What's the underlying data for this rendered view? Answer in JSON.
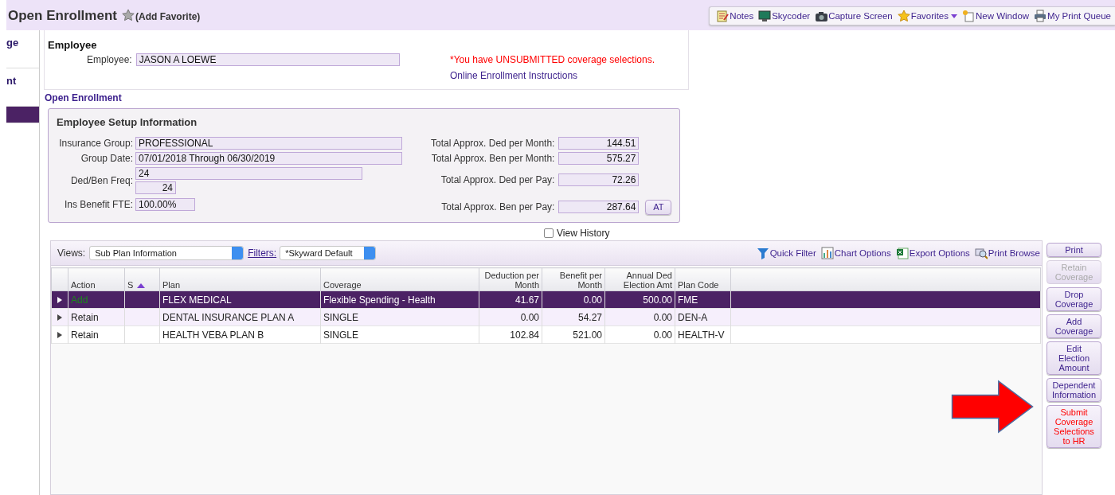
{
  "page": {
    "title": "Open Enrollment",
    "favorite": "(Add Favorite)"
  },
  "toolbar": [
    {
      "label": "Notes",
      "kind": "notes"
    },
    {
      "label": "Skycoder",
      "kind": "monitor"
    },
    {
      "label": "Capture Screen",
      "kind": "camera"
    },
    {
      "label": "Favorites",
      "kind": "star",
      "dropdown": true
    },
    {
      "label": "New Window",
      "kind": "window"
    },
    {
      "label": "My Print Queue",
      "kind": "printer"
    }
  ],
  "side_nav": [
    {
      "label": "ge",
      "selected": false
    },
    {
      "label": "nt",
      "selected": false
    },
    {
      "selected": true
    }
  ],
  "employee": {
    "heading": "Employee",
    "label": "Employee:",
    "value": "JASON A LOEWE",
    "warning": "*You have UNSUBMITTED coverage selections.",
    "link": "Online Enrollment Instructions"
  },
  "section_title": "Open Enrollment",
  "setup": {
    "title": "Employee Setup Information",
    "left_fields": [
      {
        "label": "Insurance Group:",
        "values": [
          "PROFESSIONAL"
        ]
      },
      {
        "label": "Group Date:",
        "values": [
          "07/01/2018 Through 06/30/2019"
        ]
      },
      {
        "label": "Ded/Ben Freq:",
        "values": [
          "24",
          "24"
        ]
      },
      {
        "label": "Ins Benefit FTE:",
        "values": [
          "100.00%"
        ]
      }
    ],
    "right_fields": [
      {
        "label": "Total Approx. Ded per Month:",
        "value": "144.51"
      },
      {
        "label": "Total Approx. Ben per Month:",
        "value": "575.27"
      },
      {
        "label": "Total Approx. Ded per Pay:",
        "value": "72.26"
      },
      {
        "label": "Total Approx. Ben per Pay:",
        "value": "287.64",
        "button": "AT"
      }
    ]
  },
  "view_history": {
    "label": "View History",
    "checked": false
  },
  "grid": {
    "views_label": "Views:",
    "view": "Sub Plan Information",
    "filters_label": "Filters:",
    "filter": "*Skyward Default",
    "tools": [
      {
        "label": "Quick Filter",
        "kind": "funnel"
      },
      {
        "label": "Chart Options",
        "kind": "chart"
      },
      {
        "label": "Export Options",
        "kind": "sheet"
      },
      {
        "label": "Print Browse",
        "kind": "magnifier"
      }
    ],
    "columns": [
      {
        "label": "Action",
        "kind": "text"
      },
      {
        "label": "S",
        "kind": "text",
        "sorted_ascending": true
      },
      {
        "label": "Plan",
        "kind": "text"
      },
      {
        "label": "Coverage",
        "kind": "text"
      },
      {
        "label": "Deduction per Month",
        "kind": "number"
      },
      {
        "label": "Benefit per Month",
        "kind": "number"
      },
      {
        "label": "Annual Ded Election Amt",
        "kind": "number"
      },
      {
        "label": "Plan Code",
        "kind": "text"
      }
    ],
    "rows": [
      {
        "selected": true,
        "kind": "add",
        "cells": [
          "Add",
          "",
          "FLEX MEDICAL",
          "Flexible Spending - Health",
          "41.67",
          "0.00",
          "500.00",
          "FME"
        ]
      },
      {
        "selected": false,
        "kind": "retain",
        "cells": [
          "Retain",
          "",
          "DENTAL INSURANCE PLAN A",
          "SINGLE",
          "0.00",
          "54.27",
          "0.00",
          "DEN-A"
        ]
      },
      {
        "selected": false,
        "kind": "retain",
        "cells": [
          "Retain",
          "",
          "HEALTH VEBA PLAN B",
          "SINGLE",
          "102.84",
          "521.00",
          "0.00",
          "HEALTH-V"
        ]
      }
    ]
  },
  "buttons": [
    {
      "label": "Print",
      "disabled": false,
      "kind": "normal"
    },
    {
      "label": "Retain Coverage",
      "disabled": true,
      "kind": "normal"
    },
    {
      "label": "Drop Coverage",
      "disabled": false,
      "kind": "normal"
    },
    {
      "label": "Add Coverage",
      "disabled": false,
      "kind": "normal"
    },
    {
      "label": "Edit Election Amount",
      "disabled": false,
      "kind": "normal"
    },
    {
      "label": "Dependent Information",
      "disabled": false,
      "kind": "normal"
    },
    {
      "label": "Submit Coverage Selections to HR",
      "disabled": false,
      "kind": "alert"
    }
  ]
}
